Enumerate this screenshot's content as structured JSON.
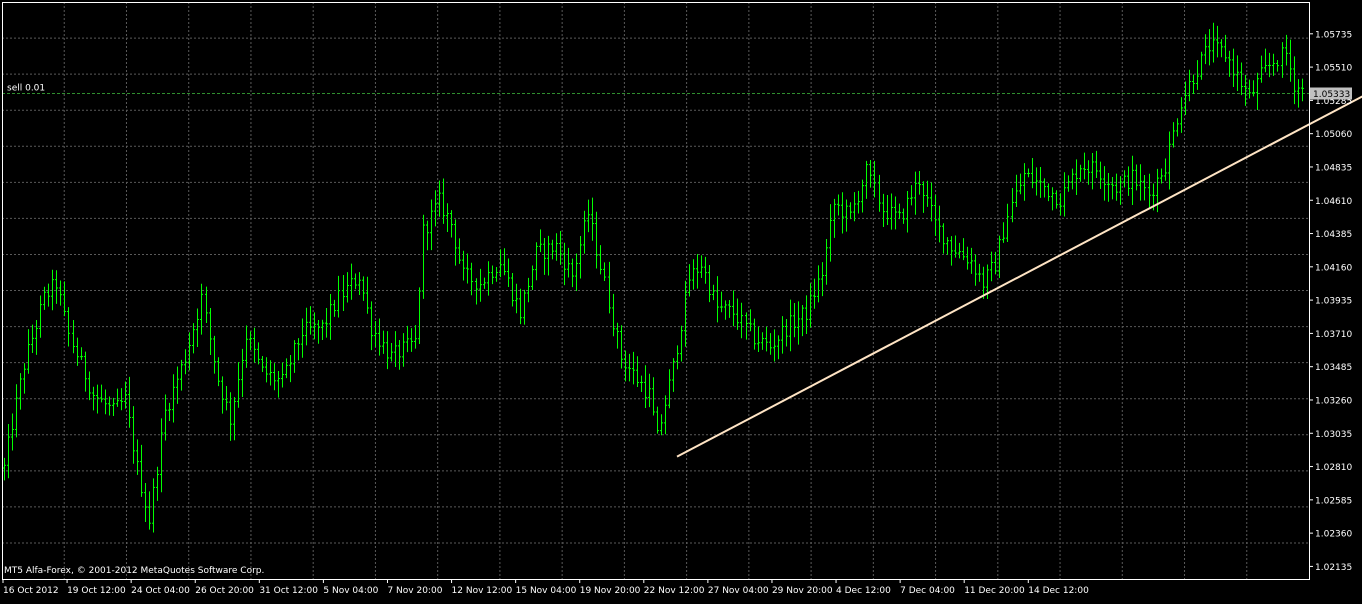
{
  "chart_data": {
    "type": "bar",
    "chart_kind": "ohlc",
    "symbol_hint": "EURCHF-like",
    "ylim": [
      1.0205,
      1.0595
    ],
    "y_ticks": [
      "1.05735",
      "1.05510",
      "1.05285",
      "1.05060",
      "1.04835",
      "1.04610",
      "1.04385",
      "1.04160",
      "1.03935",
      "1.03710",
      "1.03485",
      "1.03260",
      "1.03035",
      "1.02810",
      "1.02585",
      "1.02360",
      "1.02135"
    ],
    "x_ticks": [
      "16 Oct 2012",
      "19 Oct 12:00",
      "24 Oct 04:00",
      "26 Oct 20:00",
      "31 Oct 12:00",
      "5 Nov 04:00",
      "7 Nov 20:00",
      "12 Nov 12:00",
      "15 Nov 04:00",
      "19 Nov 20:00",
      "22 Nov 12:00",
      "27 Nov 04:00",
      "29 Nov 20:00",
      "4 Dec 12:00",
      "7 Dec 04:00",
      "11 Dec 20:00",
      "14 Dec 12:00"
    ],
    "bars_total": 332,
    "bars_drawn": 263,
    "price_path": [
      [
        0,
        1.028
      ],
      [
        2,
        1.031
      ],
      [
        5,
        1.035
      ],
      [
        10,
        1.0395
      ],
      [
        13,
        1.0405
      ],
      [
        16,
        1.037
      ],
      [
        22,
        1.033
      ],
      [
        27,
        1.0318
      ],
      [
        30,
        1.0326
      ],
      [
        33,
        1.028
      ],
      [
        36,
        1.0245
      ],
      [
        40,
        1.0318
      ],
      [
        45,
        1.0355
      ],
      [
        49,
        1.0395
      ],
      [
        53,
        1.034
      ],
      [
        56,
        1.0313
      ],
      [
        60,
        1.037
      ],
      [
        64,
        1.0345
      ],
      [
        69,
        1.0338
      ],
      [
        74,
        1.0372
      ],
      [
        79,
        1.0375
      ],
      [
        83,
        1.0395
      ],
      [
        88,
        1.041
      ],
      [
        91,
        1.0375
      ],
      [
        96,
        1.0355
      ],
      [
        102,
        1.0365
      ],
      [
        104,
        1.044
      ],
      [
        108,
        1.046
      ],
      [
        111,
        1.0445
      ],
      [
        114,
        1.041
      ],
      [
        118,
        1.0405
      ],
      [
        123,
        1.042
      ],
      [
        128,
        1.0385
      ],
      [
        132,
        1.0425
      ],
      [
        137,
        1.043
      ],
      [
        141,
        1.041
      ],
      [
        145,
        1.0452
      ],
      [
        149,
        1.0405
      ],
      [
        153,
        1.0355
      ],
      [
        157,
        1.034
      ],
      [
        160,
        1.033
      ],
      [
        162,
        1.03
      ],
      [
        166,
        1.0348
      ],
      [
        170,
        1.0408
      ],
      [
        173,
        1.0418
      ],
      [
        177,
        1.0388
      ],
      [
        181,
        1.0385
      ],
      [
        186,
        1.0368
      ],
      [
        190,
        1.0362
      ],
      [
        194,
        1.0375
      ],
      [
        199,
        1.0385
      ],
      [
        203,
        1.0412
      ],
      [
        206,
        1.0458
      ],
      [
        210,
        1.045
      ],
      [
        214,
        1.048
      ],
      [
        218,
        1.0455
      ],
      [
        222,
        1.0448
      ],
      [
        227,
        1.0475
      ],
      [
        231,
        1.0445
      ],
      [
        235,
        1.043
      ],
      [
        240,
        1.042
      ],
      [
        243,
        1.0405
      ],
      [
        246,
        1.0418
      ],
      [
        249,
        1.0452
      ],
      [
        253,
        1.0478
      ],
      [
        258,
        1.047
      ],
      [
        262,
        1.0462
      ],
      [
        267,
        1.0485
      ],
      [
        271,
        1.0482
      ],
      [
        276,
        1.047
      ],
      [
        280,
        1.0476
      ],
      [
        284,
        1.0465
      ],
      [
        288,
        1.0485
      ],
      [
        292,
        1.0528
      ],
      [
        295,
        1.0545
      ],
      [
        299,
        1.0565
      ],
      [
        303,
        1.056
      ],
      [
        306,
        1.0545
      ],
      [
        309,
        1.053
      ],
      [
        312,
        1.0545
      ],
      [
        315,
        1.0555
      ],
      [
        318,
        1.056
      ],
      [
        320,
        1.054
      ],
      [
        322,
        1.0535
      ]
    ],
    "sell_label": "sell 0.01",
    "sell_price": 1.05333,
    "current_price_label": "1.05333",
    "trendline": {
      "from_bar": 167,
      "from_price": 1.02877,
      "to_bar": 368,
      "to_price": 1.05755
    },
    "footer_text": "MT5 Alfa-Forex, © 2001-2012 MetaQuotes Software Corp.",
    "colors": {
      "background": "#000000",
      "grid": "#5a5a5a",
      "bars": "#00ff00",
      "axis_text": "#ffffff",
      "trendline": "#ffe4c4",
      "sell_line": "#2f8f2f",
      "price_box_bg": "#c0c0c0",
      "price_box_text": "#000000",
      "axis_line": "#ffffff"
    }
  }
}
